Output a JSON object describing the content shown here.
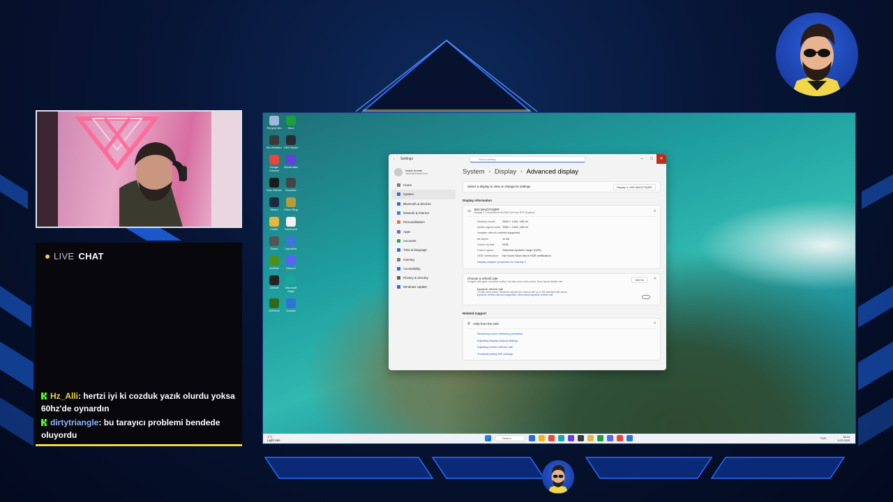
{
  "chat": {
    "title_prefix": "LIVE",
    "title": "CHAT",
    "messages": [
      {
        "user": "Hz_Alli",
        "text": ": hertzi iyi ki cozduk yazık olurdu yoksa 60hz'de oynardın"
      },
      {
        "user": "dirtytriangle",
        "text": ": bu tarayıcı problemi bendede oluyordu"
      }
    ]
  },
  "desktop": {
    "icons": [
      {
        "label": "Recycle Bin",
        "color": "#9fb7d9"
      },
      {
        "label": "Xbox",
        "color": "#1d9f3a"
      },
      {
        "label": "Bin Weather",
        "color": "#3a3a3a"
      },
      {
        "label": "OBS Studio",
        "color": "#2b2b33"
      },
      {
        "label": "Google Chrome",
        "color": "#e9453a"
      },
      {
        "label": "Streamlabs",
        "color": "#6b3ce0"
      },
      {
        "label": "Epic Games",
        "color": "#1b1b1b"
      },
      {
        "label": "Rockstar",
        "color": "#444"
      },
      {
        "label": "Steam",
        "color": "#1b2a44"
      },
      {
        "label": "Elden Ring",
        "color": "#b89b3c"
      },
      {
        "label": "Folder",
        "color": "#e4b840"
      },
      {
        "label": "Document",
        "color": "#f2f2f2"
      },
      {
        "label": "Game",
        "color": "#555"
      },
      {
        "label": "Launcher",
        "color": "#3b78d8"
      },
      {
        "label": "NVIDIA",
        "color": "#4e8f1a"
      },
      {
        "label": "Discord",
        "color": "#5865f2"
      },
      {
        "label": "Ubisoft",
        "color": "#222"
      },
      {
        "label": "Microsoft Edge",
        "color": "#1aa6a0"
      },
      {
        "label": "GeForce",
        "color": "#2f6a1a"
      },
      {
        "label": "Control",
        "color": "#2e74d6"
      }
    ]
  },
  "settings": {
    "window_title": "Settings",
    "search_placeholder": "Find a setting",
    "profile_name": "hasan duman",
    "profile_sub": "hasan@hotmail.com",
    "nav": [
      {
        "label": "Home",
        "color": "#7a7a7a"
      },
      {
        "label": "System",
        "color": "#2b6cd6",
        "active": true
      },
      {
        "label": "Bluetooth & devices",
        "color": "#2b6cd6"
      },
      {
        "label": "Network & internet",
        "color": "#1e88e5"
      },
      {
        "label": "Personalisation",
        "color": "#e07a3a"
      },
      {
        "label": "Apps",
        "color": "#7a5ad6"
      },
      {
        "label": "Accounts",
        "color": "#25a36a"
      },
      {
        "label": "Time & language",
        "color": "#2b6cd6"
      },
      {
        "label": "Gaming",
        "color": "#7a7a7a"
      },
      {
        "label": "Accessibility",
        "color": "#2b6cd6"
      },
      {
        "label": "Privacy & security",
        "color": "#5a5a5a"
      },
      {
        "label": "Windows Update",
        "color": "#2b6cd6"
      }
    ],
    "breadcrumb": [
      "System",
      "Display",
      "Advanced display"
    ],
    "select_display_label": "Select a display to view or change its settings",
    "select_display_value": "Display 2: MSI MAG274QRF",
    "display_info_header": "Display information",
    "monitor_name": "MSI MAG274QRF",
    "monitor_sub": "Display 2: Connected to NVIDIA GeForce RTX Graphics",
    "info": [
      {
        "k": "Desktop mode",
        "v": "2560 × 1440, 165 Hz"
      },
      {
        "k": "Active signal mode",
        "v": "2560 × 1440, 165 Hz"
      },
      {
        "k": "Variable refresh rate",
        "v": "Not supported"
      },
      {
        "k": "Bit depth",
        "v": "10-bit"
      },
      {
        "k": "Colour format",
        "v": "RGB"
      },
      {
        "k": "Colour space",
        "v": "Standard dynamic range (SDR)"
      },
      {
        "k": "HDR certification",
        "v": "Not found More about HDR certification"
      }
    ],
    "adapter_link": "Display adapter properties for Display 2",
    "refresh_title": "Choose a refresh rate",
    "refresh_sub": "A higher rate gives smoother motion, but also uses more power. More about refresh rate",
    "refresh_value": "165 Hz",
    "dynamic_title": "Dynamic refresh rate",
    "dynamic_sub": "To help save power, Windows adjusts the refresh rate up to the selected rate above",
    "dynamic_note": "Dynamic refresh rate isn't supported. More about dynamic refresh rate",
    "related_header": "Related support",
    "help_title": "Help from the web",
    "help_links": [
      "Resolving screen flickering problems",
      "Adjusting display scaling settings",
      "Adjusting screen refresh rate",
      "Troubleshooting DPI settings"
    ]
  },
  "taskbar": {
    "weather_temp": "4°C",
    "weather_text": "Light rain",
    "search_label": "Search",
    "apps": [
      "#2b6cd6",
      "#f1b31c",
      "#e9453a",
      "#1aa6a0",
      "#6b3ce0",
      "#3a3a3a",
      "#e4b840",
      "#1d9f3a",
      "#5865f2",
      "#e9453a",
      "#2e74d6"
    ],
    "tray_lang": "TUR",
    "time": "18:44",
    "date": "3.02.2025"
  },
  "colors": {
    "accent_yellow": "#f1d64a",
    "kick_green": "#53fc18",
    "frame_blue": "#1d5fd8"
  }
}
